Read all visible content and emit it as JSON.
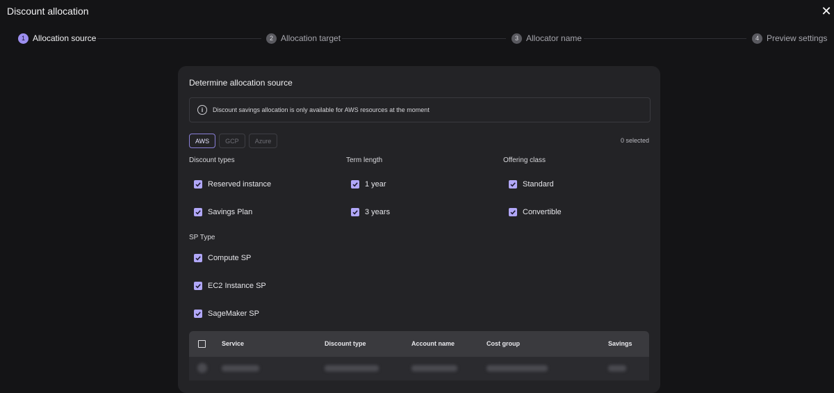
{
  "window": {
    "title": "Discount allocation"
  },
  "steps": [
    {
      "num": "1",
      "label": "Allocation source"
    },
    {
      "num": "2",
      "label": "Allocation target"
    },
    {
      "num": "3",
      "label": "Allocator name"
    },
    {
      "num": "4",
      "label": "Preview settings"
    }
  ],
  "panel": {
    "title": "Determine allocation source",
    "info": "Discount savings allocation is only available for AWS resources at the moment",
    "providers": [
      "AWS",
      "GCP",
      "Azure"
    ],
    "active_provider": "AWS",
    "selected_count": "0 selected"
  },
  "discount_types": {
    "label": "Discount types",
    "items": [
      "Reserved instance",
      "Savings Plan"
    ]
  },
  "term_length": {
    "label": "Term length",
    "items": [
      "1 year",
      "3 years"
    ]
  },
  "offering_class": {
    "label": "Offering class",
    "items": [
      "Standard",
      "Convertible"
    ]
  },
  "sp_type": {
    "label": "SP Type",
    "items": [
      "Compute SP",
      "EC2 Instance SP",
      "SageMaker SP"
    ]
  },
  "table": {
    "columns": [
      "Service",
      "Discount type",
      "Account name",
      "Cost group",
      "Savings"
    ]
  },
  "colors": {
    "accent": "#b1a7f8",
    "background": "#141416",
    "panel": "#232326"
  }
}
